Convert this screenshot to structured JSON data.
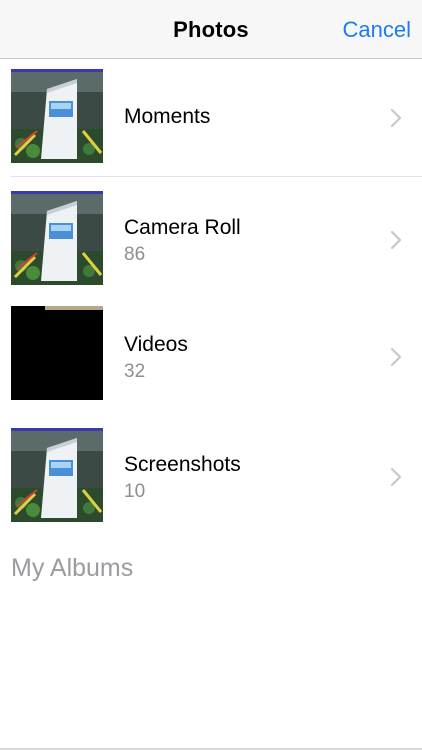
{
  "navbar": {
    "title": "Photos",
    "cancel_label": "Cancel"
  },
  "albums": [
    {
      "title": "Moments",
      "count": "",
      "thumb": "photo"
    },
    {
      "title": "Camera Roll",
      "count": "86",
      "thumb": "photo"
    },
    {
      "title": "Videos",
      "count": "32",
      "thumb": "black"
    },
    {
      "title": "Screenshots",
      "count": "10",
      "thumb": "photo"
    }
  ],
  "sections": {
    "my_albums_title": "My Albums"
  },
  "colors": {
    "accent": "#1d7cf2",
    "secondary_text": "#8e8e93",
    "navbar_bg": "#f7f7f7"
  }
}
